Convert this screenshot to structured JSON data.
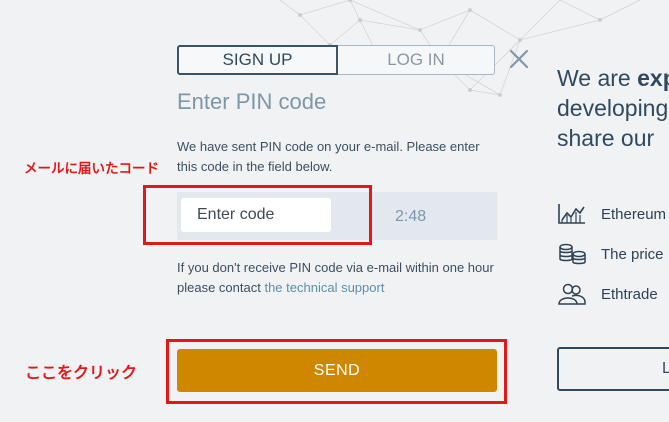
{
  "tabs": {
    "signup": "SIGN UP",
    "login": "LOG IN"
  },
  "form": {
    "heading": "Enter PIN code",
    "description": "We have sent PIN code on your e-mail. Please enter this code in the field below.",
    "code_placeholder": "Enter code",
    "timer": "2:48",
    "help_text": "If you don't receive PIN code via e-mail within one hour please contact",
    "support_link": "the technical support",
    "send_label": "SEND"
  },
  "annotations": {
    "code_label": "メールに届いたコード",
    "click_label": "ここをクリック"
  },
  "right_panel": {
    "line1_prefix": "We are ",
    "line1_bold": "exp",
    "line2": "developing",
    "line3": "share our",
    "features": [
      {
        "icon": "chart-icon",
        "label": "Ethereum"
      },
      {
        "icon": "coins-icon",
        "label": "The price"
      },
      {
        "icon": "users-icon",
        "label": "Ethtrade"
      }
    ],
    "button_label": "L"
  },
  "colors": {
    "accent": "#d08700",
    "annotation": "#e21818",
    "primary_text": "#2f4a60",
    "muted_text": "#7d96a8"
  }
}
